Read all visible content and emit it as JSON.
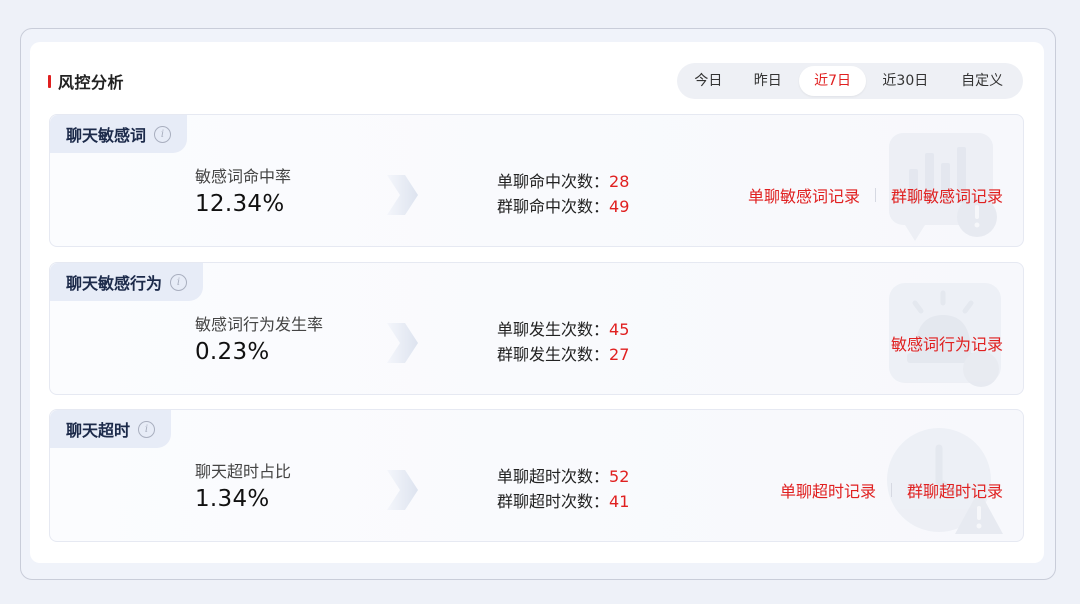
{
  "header": {
    "title": "风控分析"
  },
  "tabs": [
    {
      "label": "今日",
      "active": false
    },
    {
      "label": "昨日",
      "active": false
    },
    {
      "label": "近7日",
      "active": true
    },
    {
      "label": "近30日",
      "active": false
    },
    {
      "label": "自定义",
      "active": false
    }
  ],
  "cards": [
    {
      "title": "聊天敏感词",
      "metric_label": "敏感词命中率",
      "metric_value": "12.34%",
      "stats": [
        {
          "label": "单聊命中次数：",
          "value": "28"
        },
        {
          "label": "群聊命中次数：",
          "value": "49"
        }
      ],
      "links": [
        "单聊敏感词记录",
        "群聊敏感词记录"
      ],
      "icon": "chart-warning-icon"
    },
    {
      "title": "聊天敏感行为",
      "metric_label": "敏感词行为发生率",
      "metric_value": "0.23%",
      "stats": [
        {
          "label": "单聊发生次数：",
          "value": "45"
        },
        {
          "label": "群聊发生次数：",
          "value": "27"
        }
      ],
      "links": [
        "敏感词行为记录"
      ],
      "icon": "alarm-icon"
    },
    {
      "title": "聊天超时",
      "metric_label": "聊天超时占比",
      "metric_value": "1.34%",
      "stats": [
        {
          "label": "单聊超时次数：",
          "value": "52"
        },
        {
          "label": "群聊超时次数：",
          "value": "41"
        }
      ],
      "links": [
        "单聊超时记录",
        "群聊超时记录"
      ],
      "icon": "timeout-warning-icon"
    }
  ],
  "colors": {
    "accent": "#e02020",
    "tag_bg": "#e7ecf7",
    "page_bg": "#eef1f8"
  }
}
